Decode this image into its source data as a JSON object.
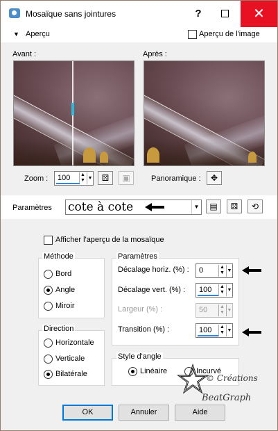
{
  "window": {
    "title": "Mosaïque sans jointures",
    "help_glyph": "?",
    "close_glyph": "✕"
  },
  "preview_section": {
    "toggle_label": "Aperçu",
    "show_image_label": "Aperçu de l'image",
    "show_image_checked": false,
    "before_label": "Avant :",
    "after_label": "Après :",
    "zoom_label": "Zoom :",
    "zoom_value": "100",
    "pan_label": "Panoramique :"
  },
  "presets": {
    "label": "Paramètres",
    "value": "cote à cote"
  },
  "show_mosaic_preview_label": "Afficher l'aperçu de la mosaïque",
  "method": {
    "title": "Méthode",
    "options": [
      "Bord",
      "Angle",
      "Miroir"
    ],
    "selected": "Angle"
  },
  "direction": {
    "title": "Direction",
    "options": [
      "Horizontale",
      "Verticale",
      "Bilatérale"
    ],
    "selected": "Bilatérale"
  },
  "params": {
    "title": "Paramètres",
    "horiz_offset_label": "Décalage horiz. (%) :",
    "horiz_offset_value": "0",
    "vert_offset_label": "Décalage vert. (%) :",
    "vert_offset_value": "100",
    "width_label": "Largeur (%) :",
    "width_value": "50",
    "transition_label": "Transition (%) :",
    "transition_value": "100"
  },
  "corner_style": {
    "title": "Style d'angle",
    "options": [
      "Linéaire",
      "Incurvé"
    ],
    "selected": "Linéaire"
  },
  "buttons": {
    "ok": "OK",
    "cancel": "Annuler",
    "help": "Aide"
  },
  "watermark": {
    "line1": "© Créations",
    "line2": "BeatGraph"
  },
  "colors": {
    "accent": "#0078d7",
    "close_red": "#e81123",
    "desktop": "#6b4a3a"
  }
}
